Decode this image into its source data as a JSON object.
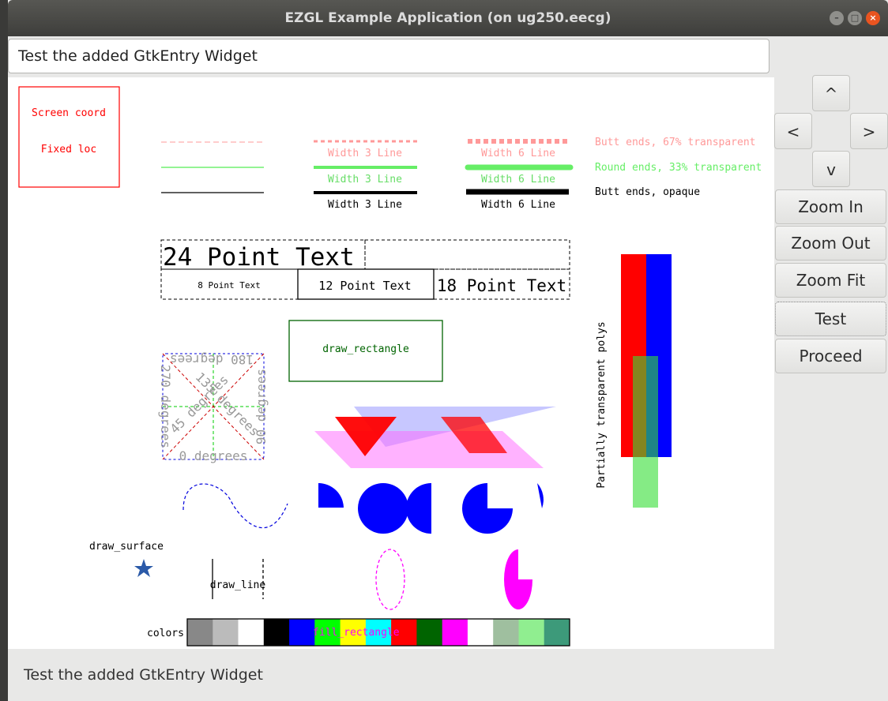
{
  "window": {
    "title": "EZGL Example Application (on ug250.eecg)",
    "controls": [
      "minimize-icon",
      "maximize-icon",
      "close-icon"
    ],
    "accent": "#e95420"
  },
  "entry": {
    "value": "Test the added GtkEntry Widget"
  },
  "sidebar": {
    "up": "^",
    "left": "<",
    "right": ">",
    "down": "v",
    "buttons": [
      "Zoom In",
      "Zoom Out",
      "Zoom Fit",
      "Test",
      "Proceed"
    ]
  },
  "status": {
    "text": "Test the added GtkEntry Widget"
  },
  "canvas": {
    "screen_coord": "Screen coord",
    "fixed_loc": "Fixed loc",
    "line_labels": {
      "w3_a": "Width 3 Line",
      "w3_b": "Width 3 Line",
      "w3_c": "Width 3 Line",
      "w6_a": "Width 6 Line",
      "w6_b": "Width 6 Line",
      "w6_c": "Width 6 Line",
      "butt67": "Butt ends, 67% transparent",
      "round33": "Round ends, 33% transparent",
      "butt_opaque": "Butt ends, opaque"
    },
    "text24": "24 Point Text",
    "text8": "8 Point Text",
    "text12": "12 Point Text",
    "text18": "18 Point Text",
    "draw_rectangle": "draw_rectangle",
    "partial_polys": "Partially transparent polys",
    "rot_0": "0 degrees",
    "rot_90": "90 degrees",
    "rot_180": "180 degrees",
    "rot_270": "270 degrees",
    "rot_45": "45 degrees",
    "rot_135": "135 degrees",
    "draw_surface": "draw_surface",
    "draw_line": "draw_line",
    "colors_label": "colors",
    "fill_rectangle": "fill_rectangle",
    "color_swatches": [
      "#888888",
      "#bbbbbb",
      "#ffffff",
      "#000000",
      "#0000ff",
      "#00ff00",
      "#ffff00",
      "#00ffff",
      "#ff0000",
      "#006400",
      "#ff00ff",
      "#ffffff",
      "#9fbf9f",
      "#90ee90",
      "#3d9a7a"
    ]
  }
}
